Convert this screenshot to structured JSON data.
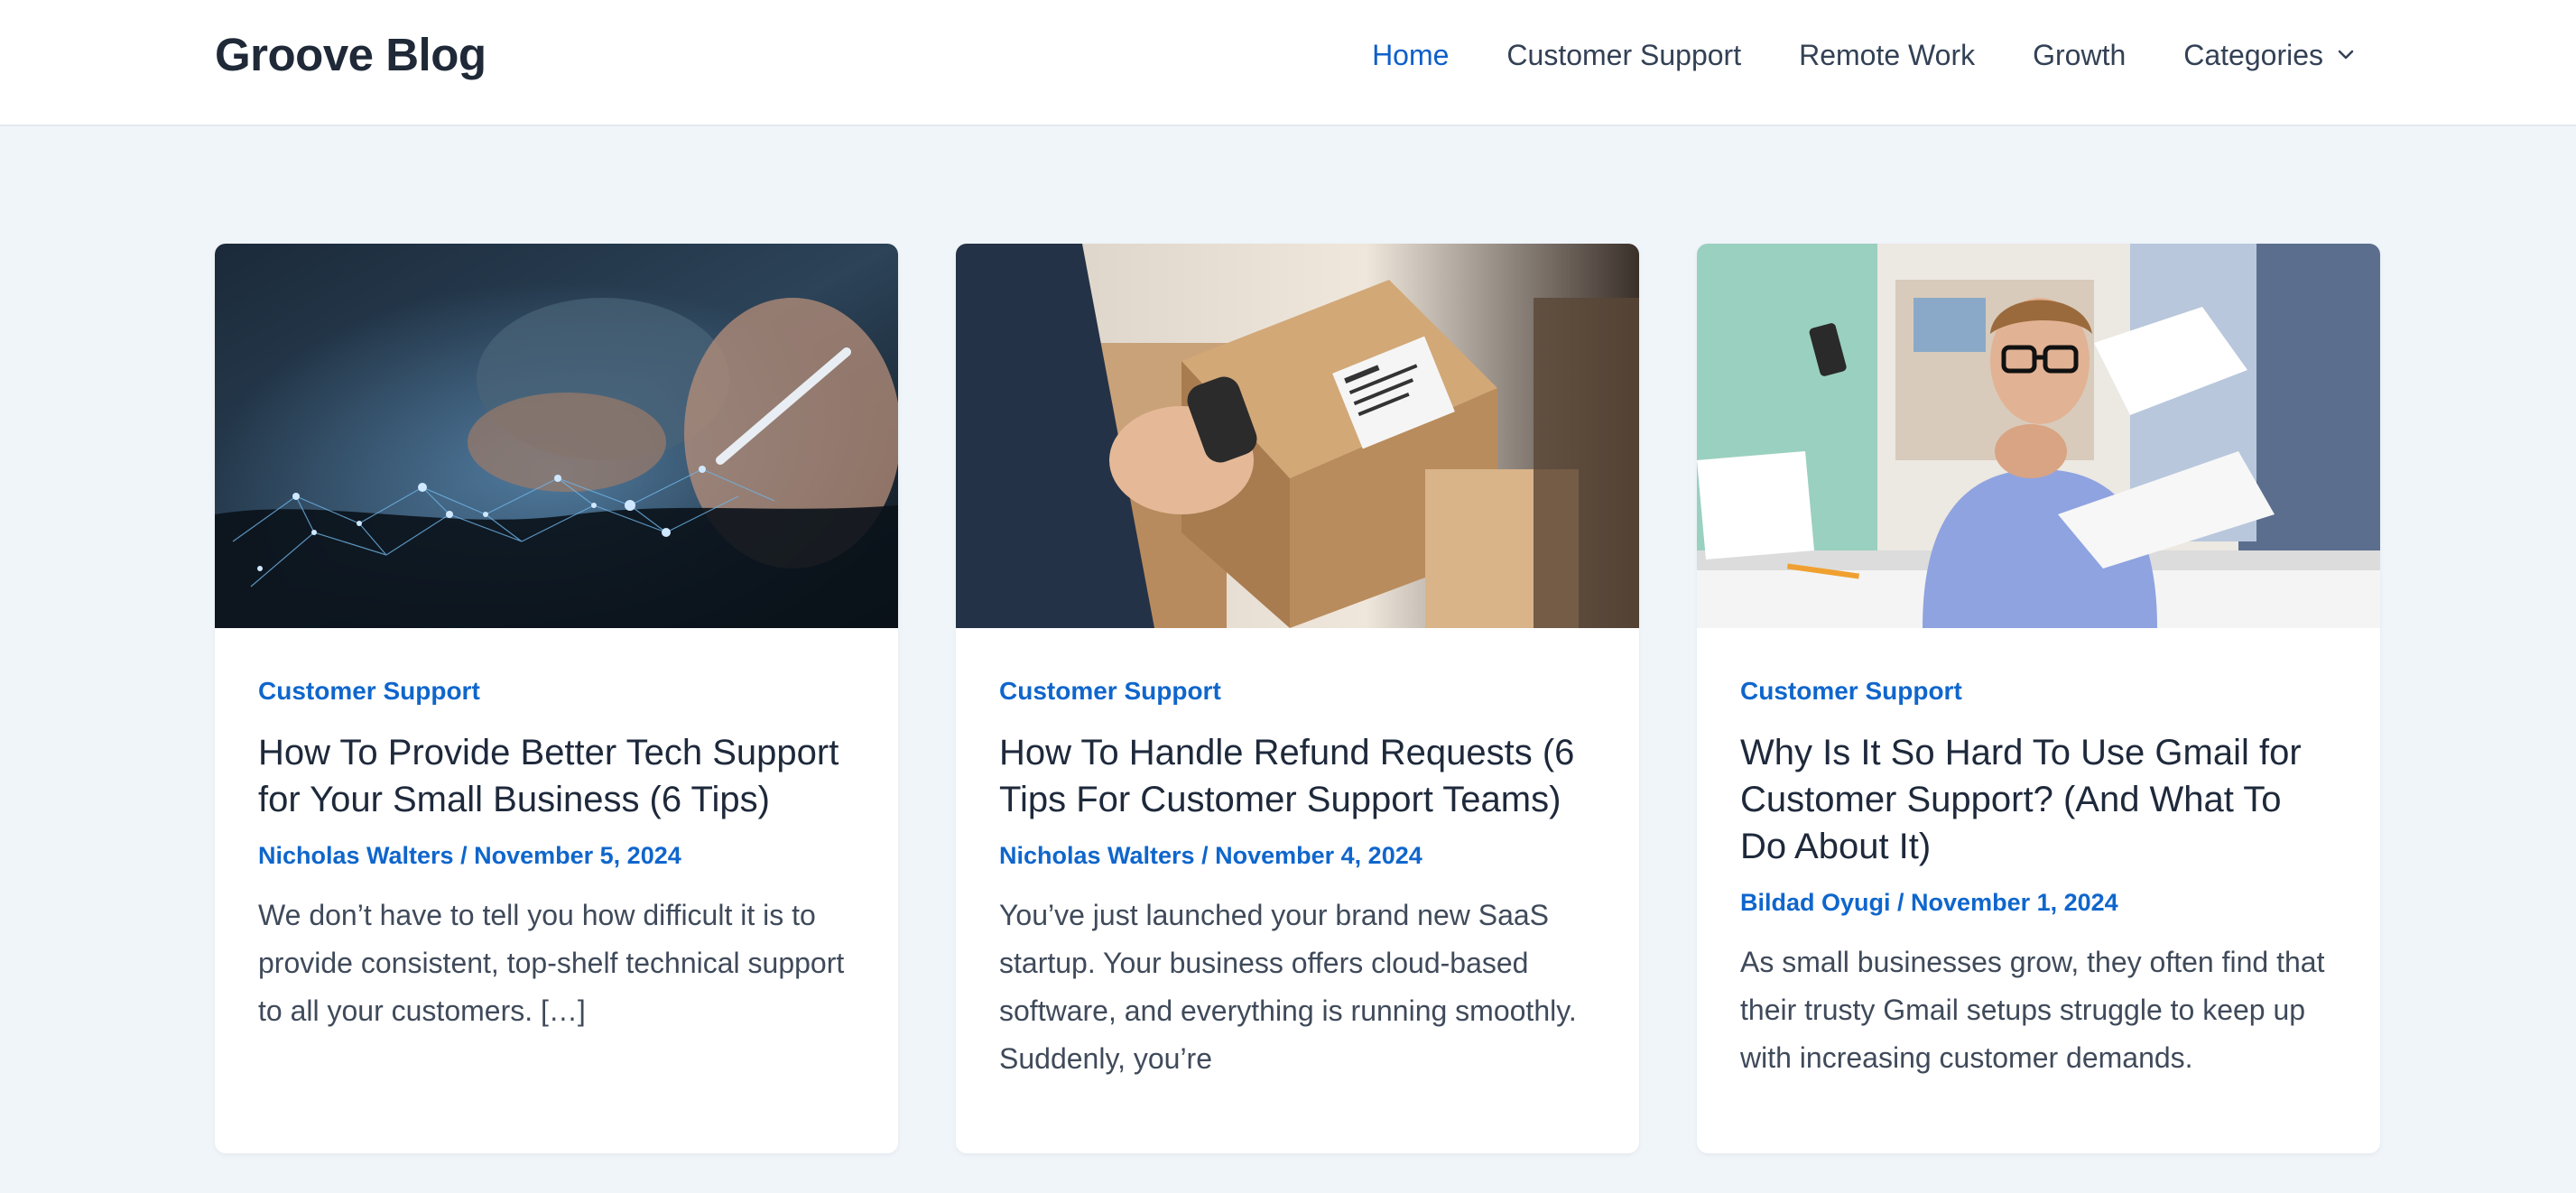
{
  "header": {
    "logo": "Groove Blog",
    "nav": [
      {
        "label": "Home",
        "active": true
      },
      {
        "label": "Customer Support",
        "active": false
      },
      {
        "label": "Remote Work",
        "active": false
      },
      {
        "label": "Growth",
        "active": false
      },
      {
        "label": "Categories",
        "active": false,
        "dropdown_icon": "chevron-down-icon"
      }
    ]
  },
  "colors": {
    "accent": "#0f66cc",
    "page_bg": "#f0f5fa",
    "card_bg": "#ffffff",
    "heading": "#1e293b"
  },
  "posts": [
    {
      "image": "tech-network-photo",
      "category": "Customer Support",
      "title": "How To Provide Better Tech Support for Your Small Business (6 Tips)",
      "author": "Nicholas Walters",
      "separator": "/",
      "date": "November 5, 2024",
      "excerpt": "We don’t have to tell you how difficult it is to provide consistent, top-shelf technical support to all your customers. […]"
    },
    {
      "image": "package-scanning-photo",
      "category": "Customer Support",
      "title": "How To Handle Refund Requests (6 Tips For Customer Support Teams)",
      "author": "Nicholas Walters",
      "separator": "/",
      "date": "November 4, 2024",
      "excerpt": "You’ve just launched your brand new SaaS startup. Your business offers cloud-based software, and everything is running smoothly. Suddenly, you’re"
    },
    {
      "image": "overwhelmed-office-worker-photo",
      "category": "Customer Support",
      "title": "Why Is It So Hard To Use Gmail for Customer Support? (And What To Do About It)",
      "author": "Bildad Oyugi",
      "separator": "/",
      "date": "November 1, 2024",
      "excerpt": "As small businesses grow, they often find that their trusty Gmail setups struggle to keep up with increasing customer demands."
    }
  ]
}
